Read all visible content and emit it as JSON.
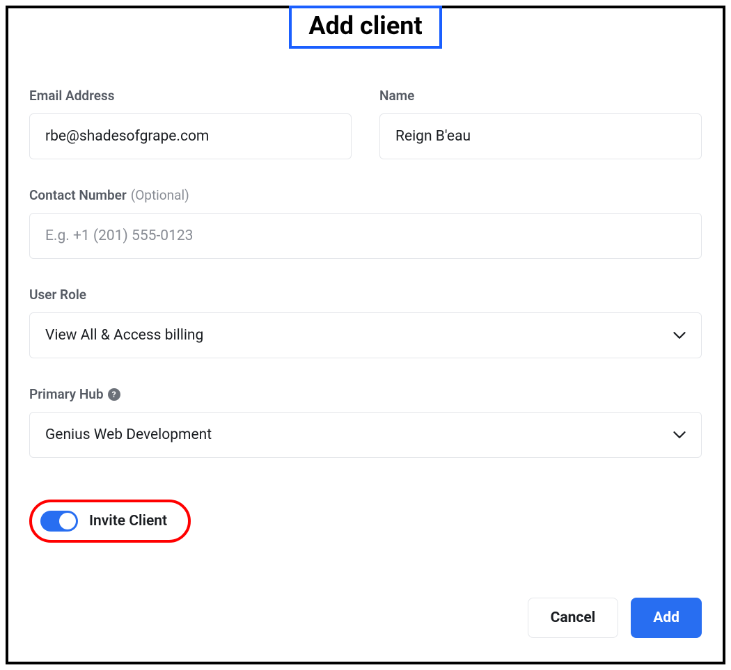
{
  "dialog": {
    "title": "Add client"
  },
  "fields": {
    "email": {
      "label": "Email Address",
      "value": "rbe@shadesofgrape.com"
    },
    "name": {
      "label": "Name",
      "value": "Reign B'eau"
    },
    "contact": {
      "label": "Contact Number",
      "optional_text": "(Optional)",
      "placeholder": "E.g. +1 (201) 555-0123",
      "value": ""
    },
    "role": {
      "label": "User Role",
      "selected": "View All & Access billing"
    },
    "hub": {
      "label": "Primary Hub",
      "help_glyph": "?",
      "selected": "Genius Web Development"
    }
  },
  "invite": {
    "label": "Invite Client",
    "enabled": true
  },
  "buttons": {
    "cancel": "Cancel",
    "add": "Add"
  }
}
